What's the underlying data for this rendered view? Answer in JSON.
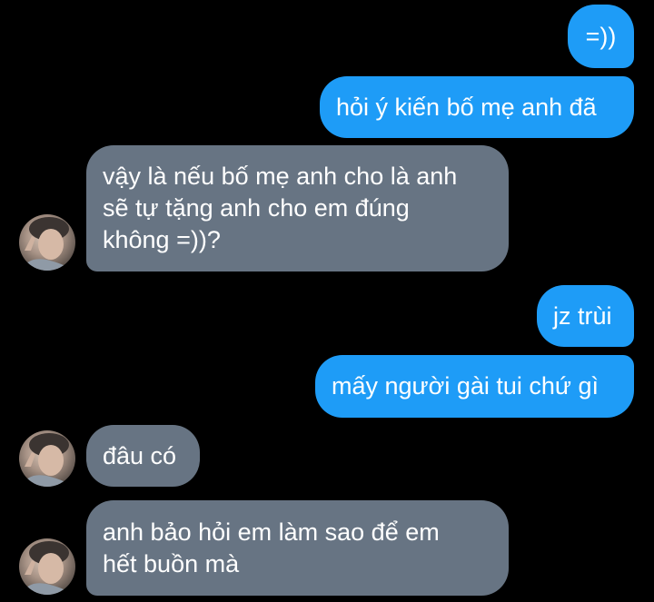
{
  "conversation": {
    "messages": [
      {
        "side": "out",
        "text": "=))"
      },
      {
        "side": "out",
        "text": "hỏi ý kiến bố mẹ anh đã"
      },
      {
        "side": "in",
        "text": "vậy là nếu bố mẹ anh cho là anh\nsẽ tự tặng anh cho em đúng\nkhông =))?"
      },
      {
        "side": "out",
        "text": "jz trùi"
      },
      {
        "side": "out",
        "text": "mấy người gài tui chứ gì"
      },
      {
        "side": "in",
        "text": "đâu có"
      },
      {
        "side": "in",
        "text": "anh bảo hỏi em làm sao để em\nhết buồn mà"
      }
    ]
  },
  "colors": {
    "background": "#000000",
    "outgoing_bubble": "#1e9cf7",
    "incoming_bubble": "#677483",
    "text": "#ffffff"
  },
  "icons": {
    "contact_avatar": "user-avatar-photo"
  }
}
